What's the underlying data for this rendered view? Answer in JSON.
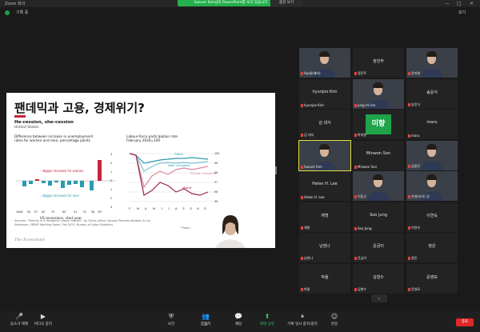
{
  "window": {
    "app_title": "Zoom 회의",
    "minimize": "—",
    "maximize": "□",
    "close": "✕"
  },
  "top": {
    "recording_label": "기록 중",
    "share_banner": "Saeum Kim님의 PowerPoint를 보고 있습니다",
    "view_option": "옵션 보기",
    "view_button": "보기"
  },
  "slide": {
    "title": "팬데믹과 고용, 경제위기?",
    "headline": "He-cession, she-cession",
    "subheadline": "United States",
    "left_chart": {
      "heading_line1": "Difference between increase in unemployment",
      "heading_line2": "rates for women and men, percentage points",
      "bigger_women": "↑ Bigger increase for women",
      "bigger_men": "↓ Bigger increase for men",
      "x_ticks": [
        "1948",
        "53",
        "57",
        "60",
        "70",
        "80",
        "91",
        "01",
        "08",
        "20*"
      ],
      "y_ticks": [
        "3",
        "2",
        "1",
        "0",
        "1",
        "2",
        "3"
      ],
      "footer": "US recessions, start year"
    },
    "right_chart": {
      "heading_line1": "Labour-force participation rate",
      "heading_line2": "February 2020=100",
      "series_labels": [
        "Father",
        "Male, not parent",
        "Female, not parent",
        "Mother"
      ],
      "y_ticks": [
        "100",
        "99",
        "98",
        "97",
        "96",
        "95"
      ],
      "x_ticks": [
        "F",
        "M",
        "A",
        "M",
        "J",
        "J",
        "A",
        "S",
        "O",
        "N",
        "D"
      ],
      "note": "*Febru"
    },
    "source": "Sources: \"Parents in a Pandemic Labour Market\", by Olivia Lofton, Nicolas Petrosky-Nadeau & Lily Seitelman, FRBSF Working Paper, Feb 2021; Bureau of Labor Statistics",
    "logo": "The Economist"
  },
  "gallery": {
    "tiles": [
      {
        "name": "",
        "tag": "HyeJi(혜지)",
        "video": true
      },
      {
        "name": "정진주",
        "tag": "정진주",
        "video": false
      },
      {
        "name": "",
        "tag": "윤지희",
        "video": true
      },
      {
        "name": "hyunjoo Kim",
        "tag": "hyunjoo Kim",
        "video": false
      },
      {
        "name": "",
        "tag": "jung mi lee",
        "video": true
      },
      {
        "name": "송윤식",
        "tag": "송윤식",
        "video": false
      },
      {
        "name": "김 대식",
        "tag": "김 대식",
        "video": false
      },
      {
        "name": "미향",
        "tag": "박미향",
        "video": false,
        "avatar": true
      },
      {
        "name": "maru",
        "tag": "maru",
        "video": false
      },
      {
        "name": "",
        "tag": "Saeum Kim",
        "video": true,
        "active": true
      },
      {
        "name": "Minwon Son",
        "tag": "Minwon Son",
        "video": false
      },
      {
        "name": "",
        "tag": "김용진",
        "video": true
      },
      {
        "name": "Helen H. Lee",
        "tag": "Helen H. Lee",
        "video": false
      },
      {
        "name": "",
        "tag": "이동규",
        "video": true
      },
      {
        "name": "",
        "tag": "손영(코치) 강",
        "video": true
      },
      {
        "name": "채명",
        "tag": "채명",
        "video": false
      },
      {
        "name": "Soo Jung",
        "tag": "Soo Jung",
        "video": false
      },
      {
        "name": "이연숙",
        "tag": "이연숙",
        "video": false
      },
      {
        "name": "남현나",
        "tag": "남현나",
        "video": false
      },
      {
        "name": "윤금이",
        "tag": "윤금이",
        "video": false
      },
      {
        "name": "정은",
        "tag": "정은",
        "video": false
      },
      {
        "name": "박율",
        "tag": "박율",
        "video": false
      },
      {
        "name": "김형수",
        "tag": "김형수",
        "video": false
      },
      {
        "name": "윤영묘",
        "tag": "윤영묘",
        "video": false
      }
    ],
    "more": "⌄"
  },
  "bottom": {
    "items": [
      {
        "label": "음소거 해제",
        "icon": "🎤"
      },
      {
        "label": "비디오 중지",
        "icon": "▶"
      },
      {
        "label": "보안",
        "icon": "⛨"
      },
      {
        "label": "참가자",
        "icon": "👥"
      },
      {
        "label": "채팅",
        "icon": "💬"
      },
      {
        "label": "화면 공유",
        "icon": "⬆"
      },
      {
        "label": "기록 일시 중지/중지",
        "icon": "⏸"
      },
      {
        "label": "반응",
        "icon": "☺"
      }
    ],
    "participant_count": "32",
    "end": "종료"
  },
  "colors": {
    "share_green": "#24b04b",
    "end_red": "#e02828",
    "econ_red": "#c8253a",
    "teal": "#2a9bb0",
    "maroon": "#9b2845"
  }
}
